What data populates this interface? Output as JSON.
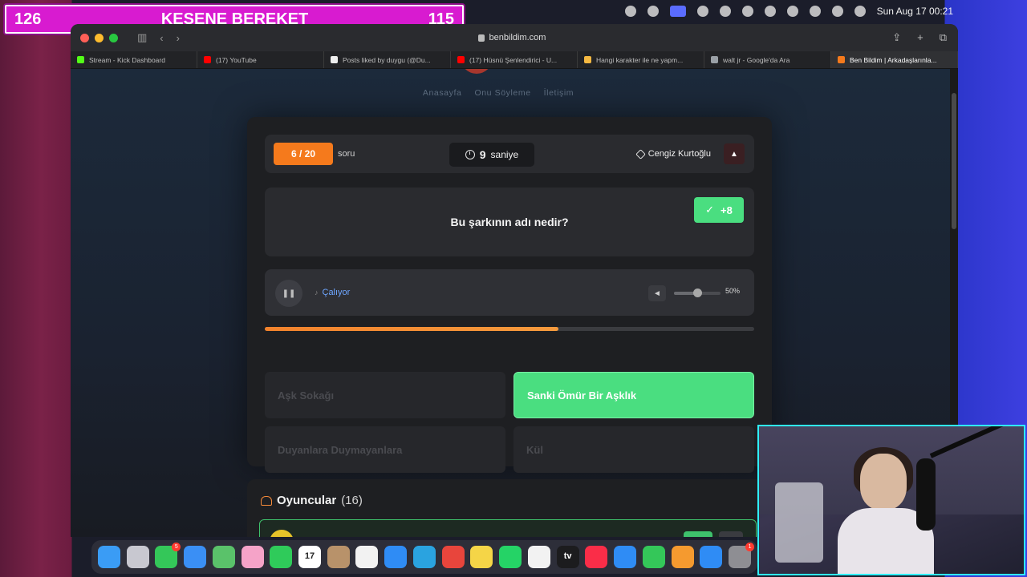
{
  "menubar": {
    "clock": "Sun Aug 17  00:21"
  },
  "banner": {
    "left_count": "126",
    "title": "KESENE BEREKET",
    "right_count": "115"
  },
  "browser": {
    "url": "benbildim.com",
    "tabs": [
      {
        "label": "Stream - Kick Dashboard",
        "color": "#53fc18"
      },
      {
        "label": "(17) YouTube",
        "color": "#ff0000"
      },
      {
        "label": "Posts liked by duygu (@Du...",
        "color": "#eeeeee"
      },
      {
        "label": "(17) Hüsnü Şenlendirici - U...",
        "color": "#ff0000"
      },
      {
        "label": "Hangi karakter ile ne yapm...",
        "color": "#f5b942"
      },
      {
        "label": "walt jr - Google'da Ara",
        "color": "#9aa0a6"
      },
      {
        "label": "Ben Bildim | Arkadaşlarınla...",
        "color": "#f57a1c"
      }
    ]
  },
  "site": {
    "nav": [
      "Anasayfa",
      "Onu Söyleme",
      "İletişim"
    ]
  },
  "quiz": {
    "counter": "6 / 20",
    "counter_suffix": "soru",
    "timer_value": "9",
    "timer_unit": "saniye",
    "artist": "Cengiz Kurtoğlu",
    "question": "Bu şarkının adı nedir?",
    "score": "+8",
    "player_status": "Çalıyor",
    "volume_label": "50%",
    "volume_level": 0.5,
    "progress_level": 0.6,
    "options": [
      {
        "label": "Aşk Sokağı",
        "state": "dimmed"
      },
      {
        "label": "Sanki Ömür Bir Aşklık",
        "state": "correct"
      },
      {
        "label": "Duyanlara Duymayanlara",
        "state": "dimmed"
      },
      {
        "label": "Kül",
        "state": "dimmed"
      }
    ]
  },
  "players": {
    "title": "Oyuncular",
    "count": "(16)"
  },
  "dock": {
    "apps": [
      {
        "name": "Finder",
        "color": "#3a9cf5"
      },
      {
        "name": "Launchpad",
        "color": "#c8c8d0"
      },
      {
        "name": "Messages",
        "color": "#34c759",
        "badge": "5"
      },
      {
        "name": "Mail",
        "color": "#3a8ff5"
      },
      {
        "name": "Maps",
        "color": "#5ac26a"
      },
      {
        "name": "Photos",
        "color": "#f5a3c8"
      },
      {
        "name": "FaceTime",
        "color": "#2fcb5a"
      },
      {
        "name": "Calendar",
        "color": "#ffffff",
        "label": "17"
      },
      {
        "name": "Contacts",
        "color": "#b8926a"
      },
      {
        "name": "Reminders",
        "color": "#f2f2f2"
      },
      {
        "name": "Safari",
        "color": "#2f8cf5"
      },
      {
        "name": "Telegram",
        "color": "#2aa3e0"
      },
      {
        "name": "Chrome",
        "color": "#e8453c"
      },
      {
        "name": "Notes",
        "color": "#f5d547"
      },
      {
        "name": "WhatsApp",
        "color": "#25d366"
      },
      {
        "name": "Freeform",
        "color": "#f2f2f2"
      },
      {
        "name": "TV",
        "color": "#1c1c1e",
        "label": "tv"
      },
      {
        "name": "Music",
        "color": "#fa2d48"
      },
      {
        "name": "Keynote",
        "color": "#2f8cf5"
      },
      {
        "name": "Numbers",
        "color": "#34c759"
      },
      {
        "name": "Pages",
        "color": "#f59a2f"
      },
      {
        "name": "App Store",
        "color": "#2f8cf5"
      },
      {
        "name": "System Settings",
        "color": "#8e8e93",
        "badge": "1"
      }
    ]
  }
}
